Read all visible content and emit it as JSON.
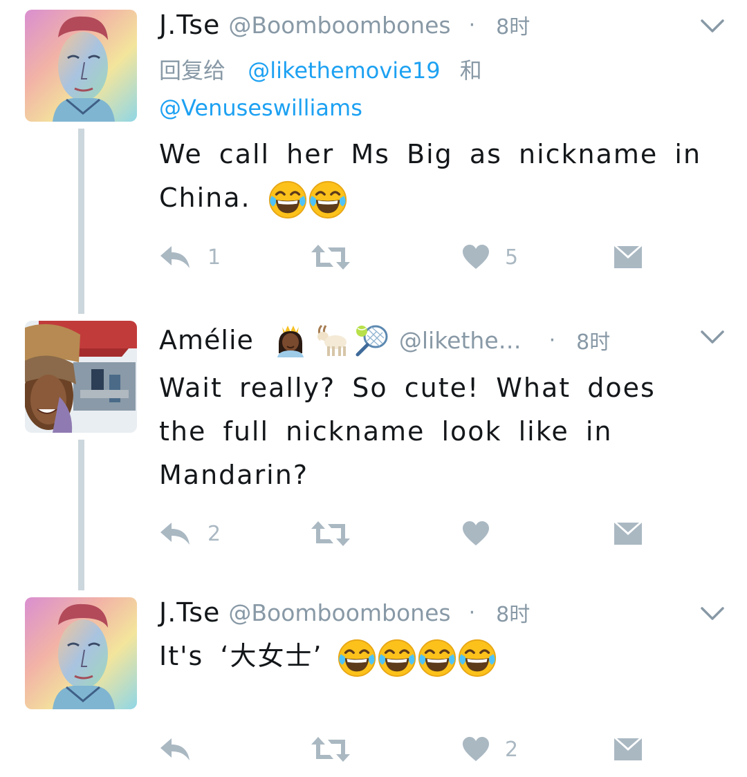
{
  "colors": {
    "icon_gray": "#aab8c2",
    "meta_gray": "#8899a6",
    "link_blue": "#1da1f2",
    "thread_line": "#ccd6dd",
    "text": "#14171a"
  },
  "tweets": [
    {
      "display_name": "J.Tse",
      "handle": "@Boomboombones",
      "separator": "·",
      "time": "8时",
      "reply_prefix": "回复给",
      "reply_mentions": [
        "@likethemovie19",
        "@Venuseswilliams"
      ],
      "reply_conjunction": "和",
      "text": "We call her Ms Big as nickname in China.",
      "text_emojis": [
        "face-with-tears-of-joy",
        "face-with-tears-of-joy"
      ],
      "reply_count": "1",
      "retweet_count": "",
      "like_count": "5",
      "icons": [
        "reply-icon",
        "retweet-icon",
        "heart-icon",
        "direct-message-icon",
        "chevron-down-icon"
      ]
    },
    {
      "display_name": "Amélie",
      "name_emojis": [
        "princess-dark-skin-tone",
        "goat",
        "tennis"
      ],
      "handle": "@likethe…",
      "separator": "·",
      "time": "8时",
      "text": "Wait really? So cute! What does the full nickname look like in Mandarin?",
      "reply_count": "2",
      "retweet_count": "",
      "like_count": "",
      "icons": [
        "reply-icon",
        "retweet-icon",
        "heart-icon",
        "direct-message-icon",
        "chevron-down-icon"
      ]
    },
    {
      "display_name": "J.Tse",
      "handle": "@Boomboombones",
      "separator": "·",
      "time": "8时",
      "text": "It's ‘大女士’",
      "text_emojis": [
        "face-with-tears-of-joy",
        "face-with-tears-of-joy",
        "face-with-tears-of-joy",
        "face-with-tears-of-joy"
      ],
      "reply_count": "",
      "retweet_count": "",
      "like_count": "2",
      "icons": [
        "reply-icon",
        "retweet-icon",
        "heart-icon",
        "direct-message-icon",
        "chevron-down-icon"
      ]
    }
  ]
}
